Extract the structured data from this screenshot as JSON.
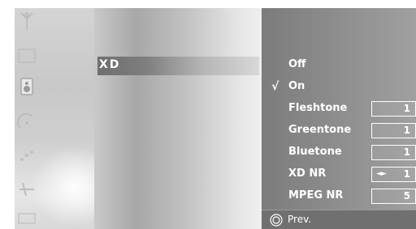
{
  "sidebar": {
    "icons": [
      "antenna-icon",
      "picture-icon",
      "speaker-icon",
      "clock-icon",
      "option-icon",
      "setup-icon",
      "input-icon"
    ]
  },
  "submenu": {
    "selected_label": "XD"
  },
  "options": {
    "mode_items": [
      {
        "label": "Off",
        "checked": false
      },
      {
        "label": "On",
        "checked": true
      }
    ],
    "check_mark": "√",
    "settings": [
      {
        "label": "Fleshtone",
        "value": "1"
      },
      {
        "label": "Greentone",
        "value": "1"
      },
      {
        "label": "Bluetone",
        "value": "1"
      },
      {
        "label": "XD NR",
        "value": "1",
        "arrows": "◄►"
      },
      {
        "label": "MPEG NR",
        "value": "5"
      }
    ]
  },
  "footer": {
    "prev_label": "Prev."
  },
  "colors": {
    "panel_gray": "#8a8a8a",
    "text_white": "#ffffff"
  }
}
